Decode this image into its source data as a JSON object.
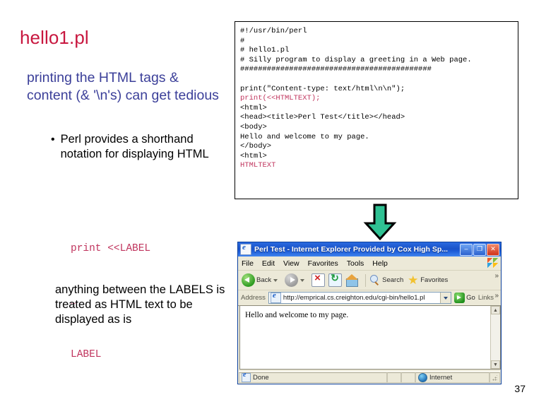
{
  "slide": {
    "title": "hello1.pl",
    "subhead": "printing the HTML tags & content (& '\\n's) can get tedious",
    "bullet": "Perl provides a shorthand notation for displaying HTML",
    "bullet_marker": "•",
    "closing_note": "anything between the LABELS is treated as HTML text to be displayed as is",
    "page_number": "37",
    "colors": {
      "title": "#c8173f",
      "subhead": "#3b3f99",
      "body": "#000000",
      "code_highlight": "#c0355e",
      "arrow_fill": "#2fc193",
      "arrow_stroke": "#000000"
    }
  },
  "snippet": {
    "lines": [
      "print <<LABEL",
      "…",
      "LABEL"
    ]
  },
  "code_box": {
    "lines": [
      {
        "text": "#!/usr/bin/perl",
        "highlight": false
      },
      {
        "text": "#",
        "highlight": false
      },
      {
        "text": "# hello1.pl",
        "highlight": false
      },
      {
        "text": "# Silly program to display a greeting in a Web page.",
        "highlight": false
      },
      {
        "text": "###########################################",
        "highlight": false
      },
      {
        "text": "",
        "highlight": false
      },
      {
        "text": "print(\"Content-type: text/html\\n\\n\");",
        "highlight": false
      },
      {
        "text": "print(<<HTMLTEXT);",
        "highlight": true
      },
      {
        "text": "<html>",
        "highlight": false
      },
      {
        "text": "<head><title>Perl Test</title></head>",
        "highlight": false
      },
      {
        "text": "<body>",
        "highlight": false
      },
      {
        "text": "Hello and welcome to my page.",
        "highlight": false
      },
      {
        "text": "</body>",
        "highlight": false
      },
      {
        "text": "<html>",
        "highlight": false
      },
      {
        "text": "HTMLTEXT",
        "highlight": true
      }
    ]
  },
  "browser": {
    "title": "Perl Test - Internet Explorer Provided by Cox High Sp...",
    "window_buttons": {
      "minimize": "–",
      "maximize": "❐",
      "close": "✕"
    },
    "menus": [
      "File",
      "Edit",
      "View",
      "Favorites",
      "Tools",
      "Help"
    ],
    "toolbar": {
      "back_label": "Back",
      "forward_label": "",
      "search_label": "Search",
      "favorites_label": "Favorites",
      "overflow": "»"
    },
    "address": {
      "label": "Address",
      "url": "http://emprical.cs.creighton.edu/cgi-bin/hello1.pl",
      "go_label": "Go",
      "links_label": "Links",
      "overflow": "»"
    },
    "page_content": "Hello and welcome to my page.",
    "scrollbar": {
      "up": "▲",
      "down": "▼"
    },
    "status": {
      "left": "Done",
      "zone": "Internet"
    }
  }
}
